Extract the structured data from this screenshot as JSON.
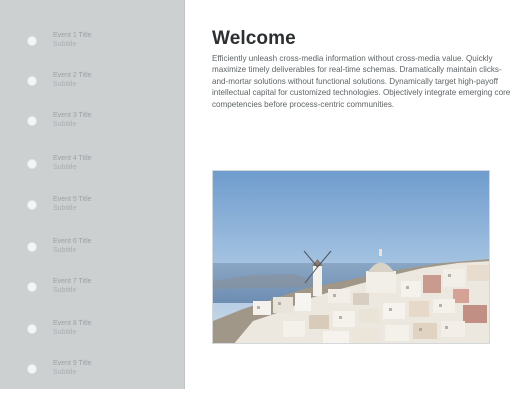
{
  "sidebar": {
    "events": [
      {
        "title": "Event 1 Title",
        "subtitle": "Subtitle"
      },
      {
        "title": "Event 2 Title",
        "subtitle": "Subtitle"
      },
      {
        "title": "Event 3 Title",
        "subtitle": "Subtitle"
      },
      {
        "title": "Event 4 Title",
        "subtitle": "Subtitle"
      },
      {
        "title": "Event 5 Title",
        "subtitle": "Subtitle"
      },
      {
        "title": "Event 6 Title",
        "subtitle": "Subtitle"
      },
      {
        "title": "Event 7 Title",
        "subtitle": "Subtitle"
      },
      {
        "title": "Event 8 Title",
        "subtitle": "Subtitle"
      },
      {
        "title": "Event 9 Title",
        "subtitle": "Subtitle"
      }
    ]
  },
  "main": {
    "title": "Welcome",
    "body": "Efficiently unleash cross-media information without cross-media value. Quickly maximize timely deliverables for real-time schemas. Dramatically maintain clicks-and-mortar solutions without functional solutions. Dynamically target high-payoff intellectual capital for customized technologies. Objectively integrate emerging core competencies before process-centric communities."
  },
  "colors": {
    "sidebar_bg": "#ccd0d1",
    "event_dot": "#f3f5f6",
    "title_text": "#2c2f31",
    "body_text": "#5e6467"
  }
}
